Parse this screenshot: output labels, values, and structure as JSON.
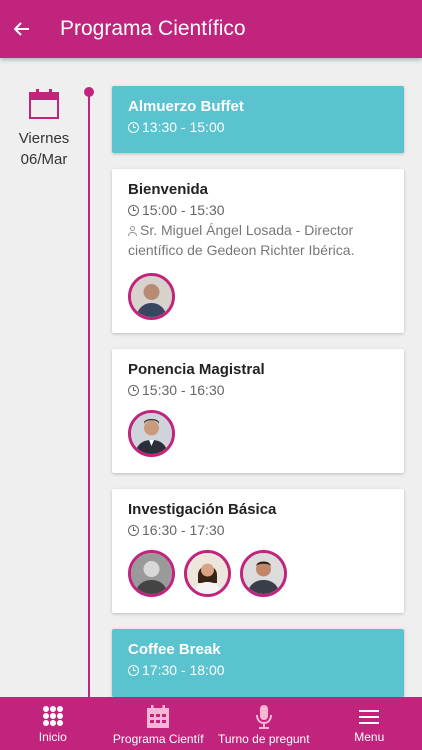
{
  "header": {
    "title": "Programa Científico",
    "back_icon": "arrow-left-icon"
  },
  "day": {
    "weekday": "Viernes",
    "date": "06/Mar",
    "icon": "calendar-icon"
  },
  "colors": {
    "accent": "#c0247c",
    "teal": "#5bc3cf",
    "background": "#efefef"
  },
  "sessions": [
    {
      "title": "Almuerzo Buffet",
      "time": "13:30 - 15:00",
      "highlight": true
    },
    {
      "title": "Bienvenida",
      "time": "15:00 - 15:30",
      "speaker": "Sr. Miguel Ángel Losada - Director científico de Gedeon Richter Ibérica.",
      "speakers_count": 1
    },
    {
      "title": "Ponencia Magistral",
      "time": "15:30 - 16:30",
      "speakers_count": 1
    },
    {
      "title": "Investigación Básica",
      "time": "16:30 - 17:30",
      "speakers_count": 3
    },
    {
      "title": "Coffee Break",
      "time": "17:30 - 18:00",
      "highlight": true
    }
  ],
  "tabbar": [
    {
      "label": "Inicio",
      "icon": "grid-icon"
    },
    {
      "label": "Programa Científ",
      "icon": "calendar-icon"
    },
    {
      "label": "Turno de pregunt",
      "icon": "microphone-icon"
    },
    {
      "label": "Menu",
      "icon": "hamburger-menu-icon"
    }
  ]
}
